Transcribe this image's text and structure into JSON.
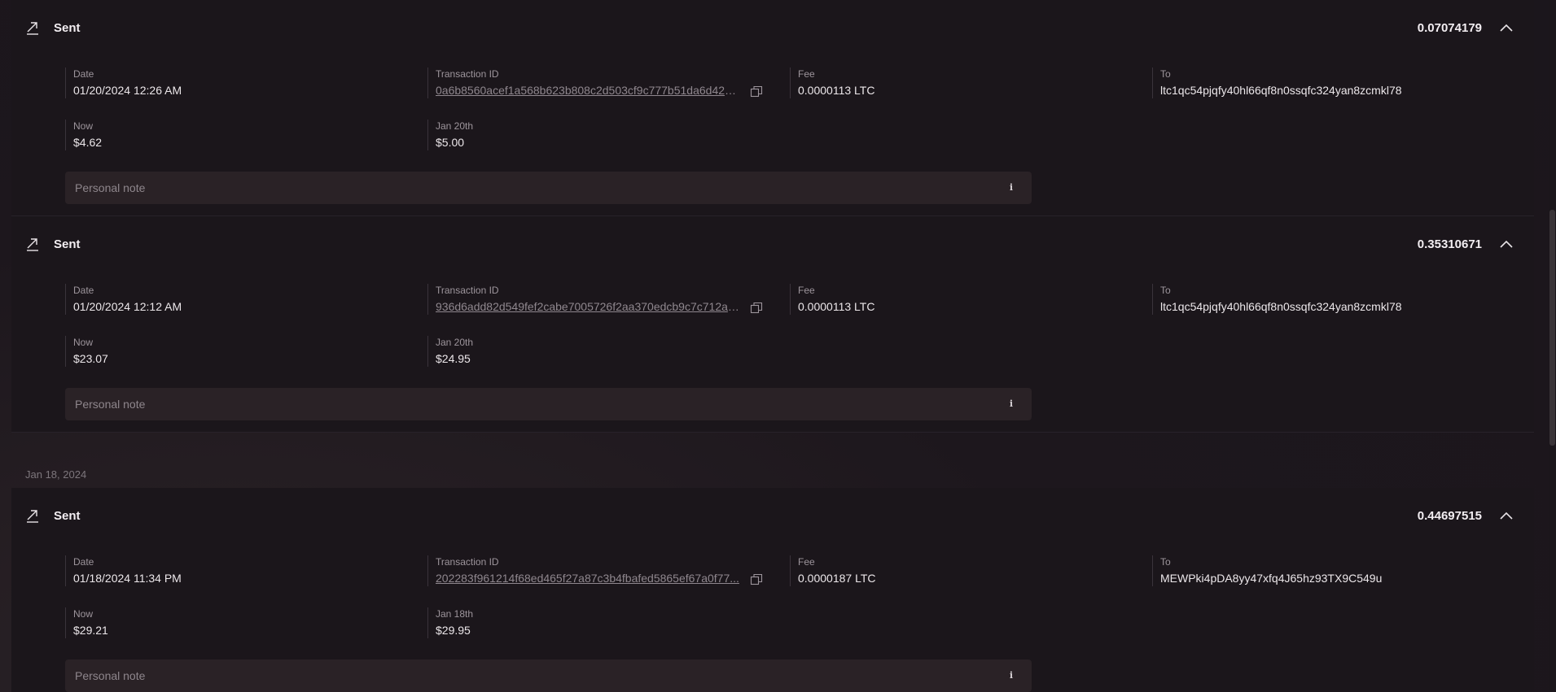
{
  "transactions": [
    {
      "type": "Sent",
      "amount": "0.07074179",
      "date_label": "Date",
      "date_value": "01/20/2024 12:26 AM",
      "txid_label": "Transaction ID",
      "txid_value": "0a6b8560acef1a568b623b808c2d503cf9c777b51da6d420...",
      "fee_label": "Fee",
      "fee_value": "0.0000113 LTC",
      "to_label": "To",
      "to_value": "ltc1qc54pjqfy40hl66qf8n0ssqfc324yan8zcmkl78",
      "now_label": "Now",
      "now_value": "$4.62",
      "hist_label": "Jan 20th",
      "hist_value": "$5.00",
      "note_placeholder": "Personal note"
    },
    {
      "type": "Sent",
      "amount": "0.35310671",
      "date_label": "Date",
      "date_value": "01/20/2024 12:12 AM",
      "txid_label": "Transaction ID",
      "txid_value": "936d6add82d549fef2cabe7005726f2aa370edcb9c7c712a6...",
      "fee_label": "Fee",
      "fee_value": "0.0000113 LTC",
      "to_label": "To",
      "to_value": "ltc1qc54pjqfy40hl66qf8n0ssqfc324yan8zcmkl78",
      "now_label": "Now",
      "now_value": "$23.07",
      "hist_label": "Jan 20th",
      "hist_value": "$24.95",
      "note_placeholder": "Personal note"
    },
    {
      "type": "Sent",
      "amount": "0.44697515",
      "date_label": "Date",
      "date_value": "01/18/2024 11:34 PM",
      "txid_label": "Transaction ID",
      "txid_value": "202283f961214f68ed465f27a87c3b4fbafed5865ef67a0f77...",
      "fee_label": "Fee",
      "fee_value": "0.0000187 LTC",
      "to_label": "To",
      "to_value": "MEWPki4pDA8yy47xfq4J65hz93TX9C549u",
      "now_label": "Now",
      "now_value": "$29.21",
      "hist_label": "Jan 18th",
      "hist_value": "$29.95",
      "note_placeholder": "Personal note"
    }
  ],
  "date_group": "Jan 18, 2024",
  "icons": {
    "sent": "arrow-up-right-icon",
    "collapse": "chevron-up-icon",
    "copy": "copy-icon",
    "info": "info-icon"
  },
  "colors": {
    "background": "#1d171d",
    "card": "#1b161b",
    "note_background": "#2a2226",
    "text_primary": "#ece7ea",
    "text_muted": "#9d959c"
  }
}
